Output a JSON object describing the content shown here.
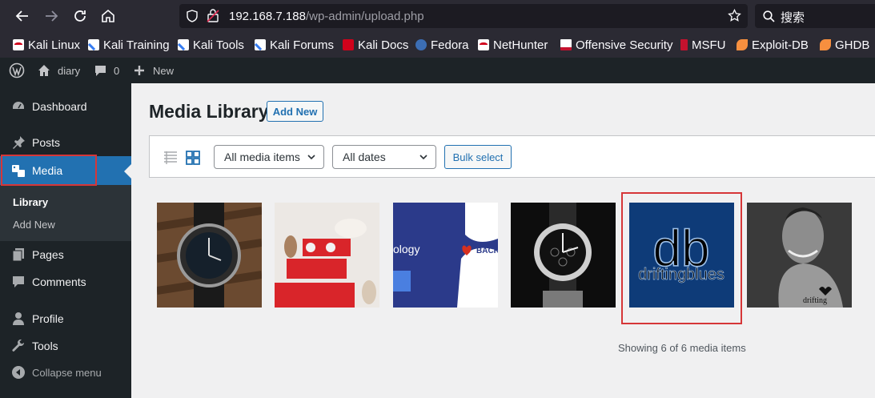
{
  "browser": {
    "url_host": "192.168.7.188",
    "url_path": "/wp-admin/upload.php",
    "search_placeholder": "搜索",
    "bookmarks": [
      {
        "label": "Kali Linux",
        "icon": "kali-icon"
      },
      {
        "label": "Kali Training",
        "icon": "kali-training-icon"
      },
      {
        "label": "Kali Tools",
        "icon": "kali-tools-icon"
      },
      {
        "label": "Kali Forums",
        "icon": "kali-forums-icon"
      },
      {
        "label": "Kali Docs",
        "icon": "kali-docs-icon"
      },
      {
        "label": "Fedora",
        "icon": "fedora-icon"
      },
      {
        "label": "NetHunter",
        "icon": "nethunter-icon"
      },
      {
        "label": "Offensive Security",
        "icon": "offsec-icon"
      },
      {
        "label": "MSFU",
        "icon": "msfu-icon"
      },
      {
        "label": "Exploit-DB",
        "icon": "exploitdb-icon"
      },
      {
        "label": "GHDB",
        "icon": "ghdb-icon"
      }
    ]
  },
  "adminbar": {
    "site_name": "diary",
    "comments_count": "0",
    "new_label": "New"
  },
  "sidebar": {
    "items": [
      {
        "label": "Dashboard",
        "icon": "dashboard-icon"
      },
      {
        "label": "Posts",
        "icon": "pin-icon"
      },
      {
        "label": "Media",
        "icon": "media-icon"
      },
      {
        "label": "Pages",
        "icon": "pages-icon"
      },
      {
        "label": "Comments",
        "icon": "comment-icon"
      },
      {
        "label": "Profile",
        "icon": "user-icon"
      },
      {
        "label": "Tools",
        "icon": "wrench-icon"
      },
      {
        "label": "Collapse menu",
        "icon": "collapse-icon"
      }
    ],
    "submenu": [
      {
        "label": "Library"
      },
      {
        "label": "Add New"
      }
    ]
  },
  "main": {
    "title": "Media Library",
    "add_new_label": "Add New",
    "filter_type": "All media items",
    "filter_date": "All dates",
    "bulk_select_label": "Bulk select",
    "thumb_texts": {
      "logo_big": "db",
      "logo_small": "driftingblues",
      "promo_left": "ology",
      "promo_right": "BACK",
      "chest_text": "drifting"
    },
    "showing_text": "Showing 6 of 6 media items"
  },
  "colors": {
    "wp_blue": "#2271b1",
    "admin_dark": "#1d2327",
    "highlight_red": "#d63638",
    "browser_chrome": "#2b2a33"
  }
}
